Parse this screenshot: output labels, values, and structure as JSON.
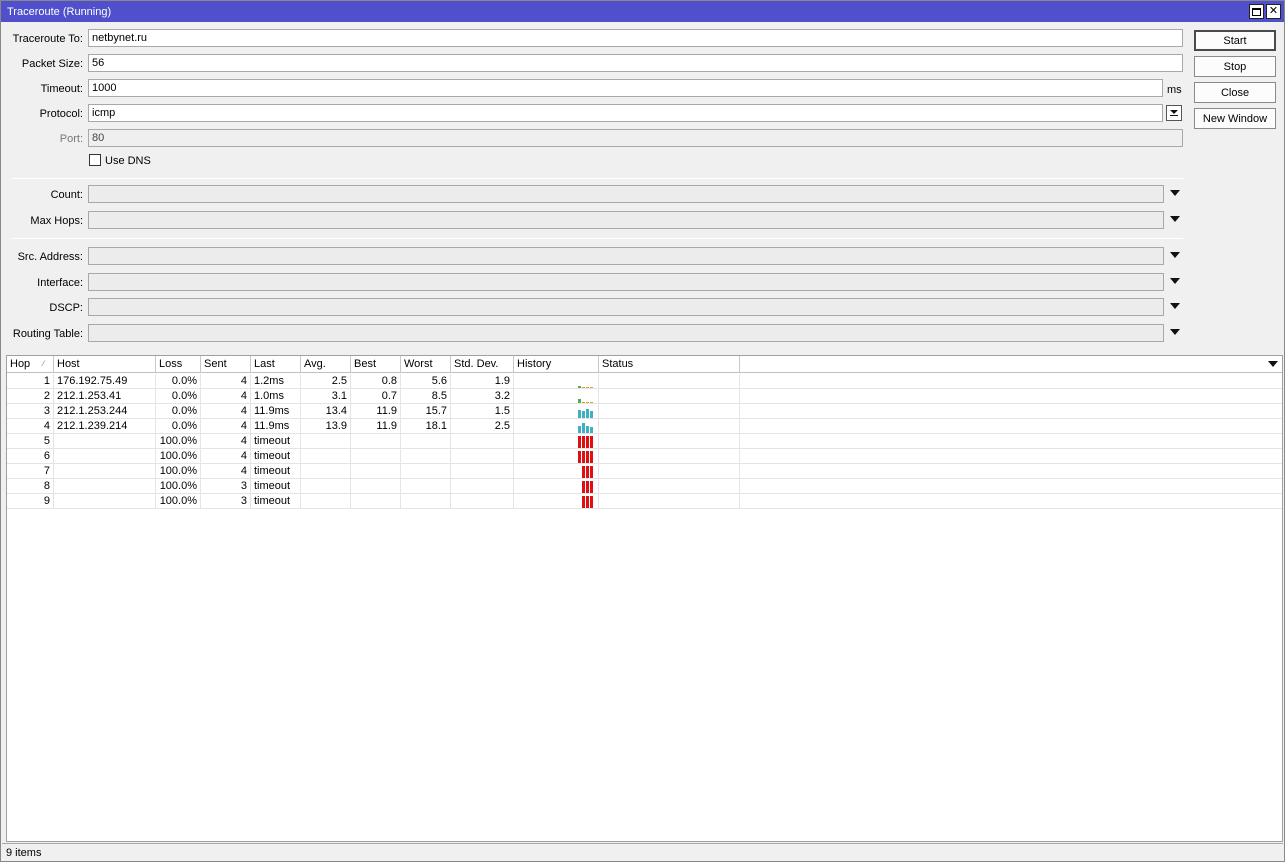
{
  "window": {
    "title": "Traceroute (Running)"
  },
  "form": {
    "traceroute_to": {
      "label": "Traceroute To:",
      "value": "netbynet.ru"
    },
    "packet_size": {
      "label": "Packet Size:",
      "value": "56"
    },
    "timeout": {
      "label": "Timeout:",
      "value": "1000",
      "unit": "ms"
    },
    "protocol": {
      "label": "Protocol:",
      "value": "icmp"
    },
    "port": {
      "label": "Port:",
      "value": "80"
    },
    "use_dns": {
      "label": "Use DNS",
      "checked": false
    },
    "count": {
      "label": "Count:",
      "value": ""
    },
    "max_hops": {
      "label": "Max Hops:",
      "value": ""
    },
    "src_address": {
      "label": "Src. Address:",
      "value": ""
    },
    "interface": {
      "label": "Interface:",
      "value": ""
    },
    "dscp": {
      "label": "DSCP:",
      "value": ""
    },
    "routing_table": {
      "label": "Routing Table:",
      "value": ""
    }
  },
  "buttons": {
    "start": "Start",
    "stop": "Stop",
    "close": "Close",
    "new_window": "New Window"
  },
  "table": {
    "columns": [
      "Hop",
      "Host",
      "Loss",
      "Sent",
      "Last",
      "Avg.",
      "Best",
      "Worst",
      "Std. Dev.",
      "History",
      "Status"
    ],
    "rows": [
      {
        "hop": "1",
        "host": "176.192.75.49",
        "loss": "0.0%",
        "sent": "4",
        "last": "1.2ms",
        "avg": "2.5",
        "best": "0.8",
        "worst": "5.6",
        "stddev": "1.9",
        "status": "",
        "history": [
          0.2,
          0.1,
          0.1,
          0.1
        ],
        "history_colors": [
          "#55aa55",
          "#e0a030",
          "#e0a030",
          "#e0a030"
        ]
      },
      {
        "hop": "2",
        "host": "212.1.253.41",
        "loss": "0.0%",
        "sent": "4",
        "last": "1.0ms",
        "avg": "3.1",
        "best": "0.7",
        "worst": "8.5",
        "stddev": "3.2",
        "status": "",
        "history": [
          0.3,
          0.1,
          0.1,
          0.1
        ],
        "history_colors": [
          "#55aa55",
          "#e0a030",
          "#e0a030",
          "#e0a030"
        ]
      },
      {
        "hop": "3",
        "host": "212.1.253.244",
        "loss": "0.0%",
        "sent": "4",
        "last": "11.9ms",
        "avg": "13.4",
        "best": "11.9",
        "worst": "15.7",
        "stddev": "1.5",
        "status": "",
        "history": [
          0.7,
          0.55,
          0.75,
          0.55
        ],
        "history_colors": [
          "#40b0c0",
          "#40b0c0",
          "#40b0c0",
          "#40b0c0"
        ]
      },
      {
        "hop": "4",
        "host": "212.1.239.214",
        "loss": "0.0%",
        "sent": "4",
        "last": "11.9ms",
        "avg": "13.9",
        "best": "11.9",
        "worst": "18.1",
        "stddev": "2.5",
        "status": "",
        "history": [
          0.6,
          0.8,
          0.55,
          0.5
        ],
        "history_colors": [
          "#40b0c0",
          "#40b0c0",
          "#40b0c0",
          "#40b0c0"
        ]
      },
      {
        "hop": "5",
        "host": "",
        "loss": "100.0%",
        "sent": "4",
        "last": "timeout",
        "avg": "",
        "best": "",
        "worst": "",
        "stddev": "",
        "status": "",
        "history": [
          1,
          1,
          1,
          1
        ],
        "history_colors": [
          "#dd1111",
          "#dd1111",
          "#dd1111",
          "#dd1111"
        ]
      },
      {
        "hop": "6",
        "host": "",
        "loss": "100.0%",
        "sent": "4",
        "last": "timeout",
        "avg": "",
        "best": "",
        "worst": "",
        "stddev": "",
        "status": "",
        "history": [
          1,
          1,
          1,
          1
        ],
        "history_colors": [
          "#dd1111",
          "#dd1111",
          "#dd1111",
          "#dd1111"
        ]
      },
      {
        "hop": "7",
        "host": "",
        "loss": "100.0%",
        "sent": "4",
        "last": "timeout",
        "avg": "",
        "best": "",
        "worst": "",
        "stddev": "",
        "status": "",
        "history": [
          1,
          1,
          1
        ],
        "history_colors": [
          "#dd1111",
          "#dd1111",
          "#dd1111"
        ]
      },
      {
        "hop": "8",
        "host": "",
        "loss": "100.0%",
        "sent": "3",
        "last": "timeout",
        "avg": "",
        "best": "",
        "worst": "",
        "stddev": "",
        "status": "",
        "history": [
          1,
          1,
          1
        ],
        "history_colors": [
          "#dd1111",
          "#dd1111",
          "#dd1111"
        ]
      },
      {
        "hop": "9",
        "host": "",
        "loss": "100.0%",
        "sent": "3",
        "last": "timeout",
        "avg": "",
        "best": "",
        "worst": "",
        "stddev": "",
        "status": "",
        "history": [
          1,
          1,
          1
        ],
        "history_colors": [
          "#dd1111",
          "#dd1111",
          "#dd1111"
        ]
      }
    ]
  },
  "status_bar": {
    "items_count": "9 items"
  },
  "colors": {
    "title_bar": "#5050cc",
    "history_ok": "#40b0c0",
    "history_timeout": "#dd1111"
  }
}
